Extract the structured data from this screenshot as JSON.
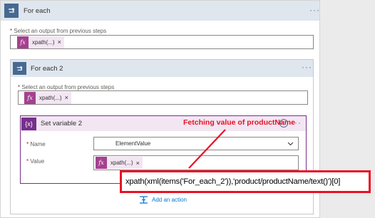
{
  "foreach1": {
    "title": "For each",
    "select_label": "Select an output from previous steps",
    "token": "xpath(...)"
  },
  "foreach2": {
    "title": "For each 2",
    "select_label": "Select an output from previous steps",
    "token": "xpath(...)"
  },
  "setvar": {
    "title": "Set variable 2",
    "name_label": "Name",
    "name_value": "ElementValue",
    "value_label": "Value",
    "value_token": "xpath(...)"
  },
  "annotation": "Fetching value of productName",
  "expression": "xpath(xml(items('For_each_2')),'product/productName/text()')[0]",
  "add_action": "Add an action",
  "colors": {
    "header_bg": "#dfe6ee",
    "loop_icon": "#486991",
    "variable_header": "#f2e6f3",
    "variable_icon": "#77308b",
    "annotation": "#e81123"
  }
}
